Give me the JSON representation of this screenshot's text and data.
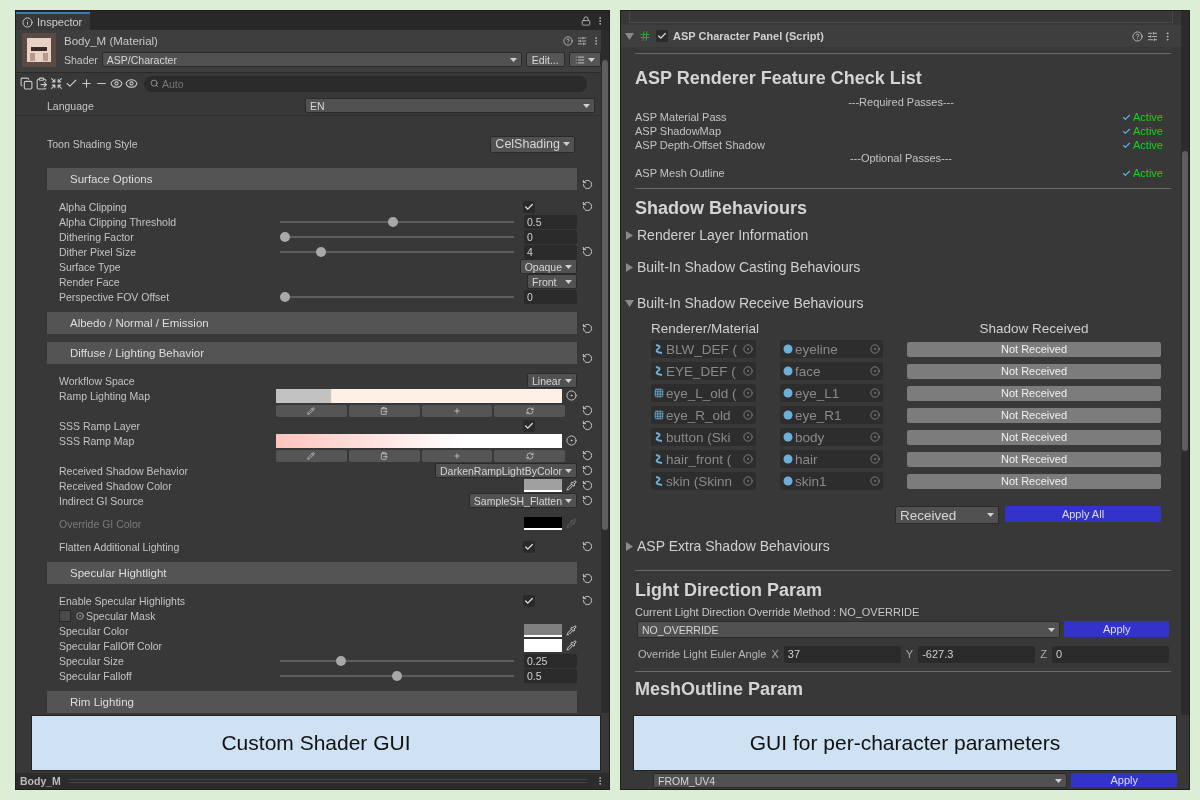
{
  "left": {
    "tab": "Inspector",
    "material": {
      "name": "Body_M (Material)",
      "shader_label": "Shader",
      "shader": "ASP/Character",
      "edit_button": "Edit..."
    },
    "search": {
      "placeholder": "Auto"
    },
    "language": {
      "label": "Language",
      "value": "EN"
    },
    "toon_style": {
      "label": "Toon Shading Style",
      "value": "CelShading"
    },
    "sections": [
      {
        "title": "Surface Options",
        "reset": true,
        "rows": [
          {
            "kind": "checkbox",
            "label": "Alpha Clipping",
            "checked": true,
            "reset": true,
            "disabled": false
          },
          {
            "kind": "slider",
            "label": "Alpha Clipping Threshold",
            "level": 0.48,
            "value": "0.5",
            "reset": false,
            "disabled": false
          },
          {
            "kind": "slider",
            "label": "Dithering Factor",
            "level": 0,
            "value": "0",
            "reset": false,
            "disabled": false
          },
          {
            "kind": "slider",
            "label": "Dither Pixel Size",
            "level": 0.16,
            "value": "4",
            "reset": true,
            "disabled": false
          },
          {
            "kind": "dropdown",
            "label": "Surface Type",
            "value": "Opaque",
            "reset": false,
            "disabled": false
          },
          {
            "kind": "dropdown",
            "label": "Render Face",
            "value": "Front",
            "reset": false,
            "disabled": false
          },
          {
            "kind": "slider",
            "label": "Perspective FOV Offset",
            "level": 0,
            "value": "0",
            "reset": false,
            "disabled": false
          }
        ]
      },
      {
        "title": "Albedo / Normal / Emission",
        "reset": true
      },
      {
        "title": "Diffuse / Lighting Behavior",
        "reset": true,
        "rows": [
          {
            "kind": "dropdown",
            "label": "Workflow Space",
            "value": "Linear",
            "reset": false,
            "disabled": false
          },
          {
            "kind": "ramp",
            "label": "Ramp Lighting Map",
            "blended": false,
            "color": "#fff0e6",
            "reset": true,
            "disabled": false
          },
          {
            "kind": "checkbox",
            "label": "SSS Ramp Layer",
            "checked": true,
            "reset": true,
            "disabled": false
          },
          {
            "kind": "ramp",
            "label": "SSS Ramp Map",
            "blended": true,
            "color": "#ffc4bc",
            "reset": true,
            "disabled": false
          },
          {
            "kind": "dropdown",
            "label": "Received Shadow Behavior",
            "value": "DarkenRampLightByColor",
            "reset": true,
            "disabled": false
          },
          {
            "kind": "color",
            "label": "Received Shadow Color",
            "color": "#a0a0a0",
            "reset": true,
            "disabled": false
          },
          {
            "kind": "dropdown",
            "label": "Indirect GI Source",
            "value": "SampleSH_Flatten",
            "reset": true,
            "disabled": false
          },
          {
            "kind": "color",
            "label": "Override GI Color",
            "color": "#000000",
            "reset": false,
            "disabled": true
          },
          {
            "kind": "checkbox",
            "label": "Flatten Additional Lighting",
            "checked": true,
            "reset": true,
            "disabled": false
          }
        ]
      },
      {
        "title": "Specular Hightlight",
        "reset": true,
        "rows": [
          {
            "kind": "checkbox",
            "label": "Enable Specular Highlights",
            "checked": true,
            "reset": true,
            "disabled": false
          },
          {
            "kind": "texture",
            "label": "Specular Mask",
            "reset": false,
            "disabled": false
          },
          {
            "kind": "color",
            "label": "Specular Color",
            "color": "#808080",
            "reset": false,
            "disabled": false
          },
          {
            "kind": "color",
            "label": "Specular FallOff Color",
            "color": "#ffffff",
            "reset": false,
            "disabled": false
          },
          {
            "kind": "slider",
            "label": "Specular Size",
            "level": 0.25,
            "value": "0.25",
            "reset": false,
            "disabled": false
          },
          {
            "kind": "slider",
            "label": "Specular Falloff",
            "level": 0.5,
            "value": "0.5",
            "reset": false,
            "disabled": false
          }
        ]
      },
      {
        "title": "Rim Lighting",
        "reset": false
      }
    ],
    "caption": "Custom Shader GUI",
    "footer": "Body_M"
  },
  "right": {
    "component": {
      "title": "ASP Character Panel (Script)",
      "enabled": true,
      "expanded": true
    },
    "check_list": {
      "heading": "ASP Renderer Feature Check List",
      "groups": [
        {
          "label": "---Required Passes---",
          "passes": [
            {
              "name": "ASP Material Pass",
              "status": "Active"
            },
            {
              "name": "ASP ShadowMap",
              "status": "Active"
            },
            {
              "name": "ASP Depth-Offset Shadow",
              "status": "Active"
            }
          ]
        },
        {
          "label": "---Optional Passes---",
          "passes": [
            {
              "name": "ASP Mesh Outline",
              "status": "Active"
            }
          ]
        }
      ]
    },
    "shadow": {
      "heading": "Shadow Behaviours",
      "foldouts": [
        {
          "label": "Renderer Layer Information",
          "expanded": false
        },
        {
          "label": "Built-In Shadow Casting Behaviours",
          "expanded": false
        },
        {
          "label": "Built-In Shadow Receive Behaviours",
          "expanded": true,
          "table": {
            "columns": [
              "Renderer/Material",
              "Shadow Received"
            ],
            "rows": [
              {
                "renderer": "BLW_DEF (",
                "kind": "skinned",
                "material": "eyeline",
                "status": "Not Received",
                "received": false
              },
              {
                "renderer": "EYE_DEF (",
                "kind": "skinned",
                "material": "face",
                "status": "Not Received",
                "received": false
              },
              {
                "renderer": "eye_L_old (",
                "kind": "mesh",
                "material": "eye_L1",
                "status": "Not Received",
                "received": false
              },
              {
                "renderer": "eye_R_old",
                "kind": "mesh",
                "material": "eye_R1",
                "status": "Not Received",
                "received": false
              },
              {
                "renderer": "button (Ski",
                "kind": "skinned",
                "material": "body",
                "status": "Not Received",
                "received": false
              },
              {
                "renderer": "hair_front (",
                "kind": "skinned",
                "material": "hair",
                "status": "Not Received",
                "received": false
              },
              {
                "renderer": "skin (Skinn",
                "kind": "skinned",
                "material": "skin1",
                "status": "Not Received",
                "received": false
              }
            ],
            "mode": "Received",
            "apply_button": "Apply All"
          }
        },
        {
          "label": "ASP Extra Shadow Behaviours",
          "expanded": false
        }
      ]
    },
    "light": {
      "heading": "Light Direction Param",
      "current": "Current Light Direction Override Method : NO_OVERRIDE",
      "method": "NO_OVERRIDE",
      "apply_button": "Apply",
      "euler": {
        "label": "Override Light Euler Angle",
        "axes": [
          {
            "axis": "X",
            "value": "37"
          },
          {
            "axis": "Y",
            "value": "-627.3"
          },
          {
            "axis": "Z",
            "value": "0"
          }
        ]
      }
    },
    "outline": {
      "heading": "MeshOutline Param",
      "method": "FROM_UV4",
      "apply_button": "Apply"
    },
    "caption": "GUI for per-character parameters"
  }
}
